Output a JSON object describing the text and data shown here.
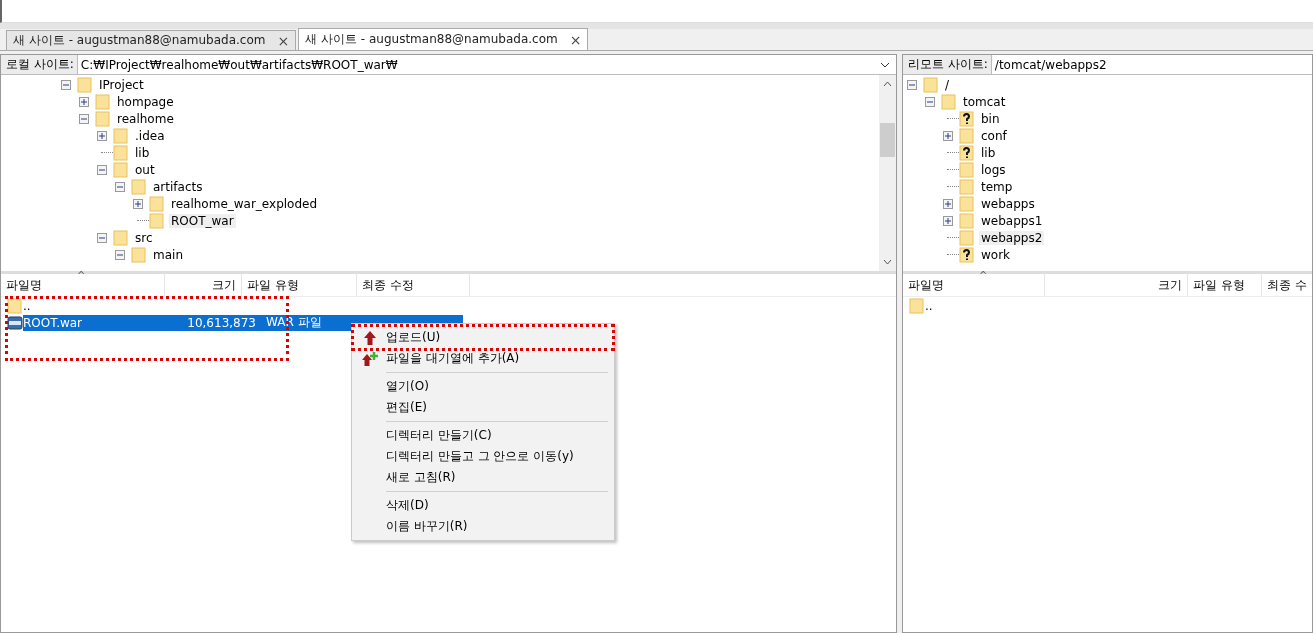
{
  "tabs": [
    {
      "label": "새 사이트 - augustman88@namubada.com",
      "close": "×",
      "selected": false
    },
    {
      "label": "새 사이트 - augustman88@namubada.com",
      "close": "×",
      "selected": true
    }
  ],
  "local": {
    "label": "로컬 사이트:",
    "path": "C:₩IProject₩realhome₩out₩artifacts₩ROOT_war₩",
    "tree": [
      {
        "name": "IProject",
        "kind": "folder",
        "expanded": true,
        "selected": false,
        "children": [
          {
            "name": "hompage",
            "kind": "folder",
            "expanded": false,
            "selected": false
          },
          {
            "name": "realhome",
            "kind": "folder",
            "expanded": true,
            "selected": false,
            "children": [
              {
                "name": ".idea",
                "kind": "folder",
                "expanded": false,
                "selected": false
              },
              {
                "name": "lib",
                "kind": "folder",
                "selected": false
              },
              {
                "name": "out",
                "kind": "folder",
                "expanded": true,
                "selected": false,
                "children": [
                  {
                    "name": "artifacts",
                    "kind": "folder",
                    "expanded": true,
                    "selected": false,
                    "children": [
                      {
                        "name": "realhome_war_exploded",
                        "kind": "folder",
                        "expanded": false,
                        "selected": false
                      },
                      {
                        "name": "ROOT_war",
                        "kind": "folder",
                        "selected": true
                      }
                    ]
                  }
                ]
              },
              {
                "name": "src",
                "kind": "folder",
                "expanded": true,
                "selected": false,
                "children": [
                  {
                    "name": "main",
                    "kind": "folder",
                    "expanded": true,
                    "selected": false
                  }
                ]
              }
            ]
          }
        ]
      }
    ],
    "columns": [
      {
        "label": "파일명",
        "sort": "^"
      },
      {
        "label": "크기"
      },
      {
        "label": "파일 유형"
      },
      {
        "label": "최종 수정"
      }
    ],
    "files": [
      {
        "name": "..",
        "kind": "folder",
        "selected": false
      },
      {
        "name": "ROOT.war",
        "kind": "war",
        "size": "10,613,873",
        "type": "WAR 파일",
        "selected": true
      }
    ]
  },
  "remote": {
    "label": "리모트 사이트:",
    "path": "/tomcat/webapps2",
    "tree": [
      {
        "name": "/",
        "kind": "folder",
        "expanded": true,
        "selected": false,
        "children": [
          {
            "name": "tomcat",
            "kind": "folder",
            "expanded": true,
            "selected": false,
            "children": [
              {
                "name": "bin",
                "kind": "unknown",
                "selected": false
              },
              {
                "name": "conf",
                "kind": "folder",
                "expanded": false,
                "selected": false
              },
              {
                "name": "lib",
                "kind": "unknown",
                "selected": false
              },
              {
                "name": "logs",
                "kind": "folder",
                "selected": false
              },
              {
                "name": "temp",
                "kind": "folder",
                "selected": false
              },
              {
                "name": "webapps",
                "kind": "folder",
                "expanded": false,
                "selected": false
              },
              {
                "name": "webapps1",
                "kind": "folder",
                "expanded": false,
                "selected": false
              },
              {
                "name": "webapps2",
                "kind": "folder",
                "selected": true
              },
              {
                "name": "work",
                "kind": "unknown",
                "selected": false
              }
            ]
          }
        ]
      }
    ],
    "columns": [
      {
        "label": "파일명",
        "sort": "^"
      },
      {
        "label": "크기"
      },
      {
        "label": "파일 유형"
      },
      {
        "label": "최종 수"
      }
    ],
    "files": [
      {
        "name": "..",
        "kind": "folder",
        "selected": false
      }
    ]
  },
  "context_menu": [
    {
      "kind": "upload",
      "label": "업로드(U)"
    },
    {
      "kind": "queue",
      "label": "파일을 대기열에 추가(A)"
    },
    {
      "kind": "separator"
    },
    {
      "kind": "item",
      "label": "열기(O)"
    },
    {
      "kind": "item",
      "label": "편집(E)"
    },
    {
      "kind": "separator"
    },
    {
      "kind": "item",
      "label": "디렉터리 만들기(C)"
    },
    {
      "kind": "item",
      "label": "디렉터리 만들고 그 안으로 이동(y)"
    },
    {
      "kind": "item",
      "label": "새로 고침(R)"
    },
    {
      "kind": "separator"
    },
    {
      "kind": "item",
      "label": "삭제(D)"
    },
    {
      "kind": "item",
      "label": "이름 바꾸기(R)"
    }
  ]
}
